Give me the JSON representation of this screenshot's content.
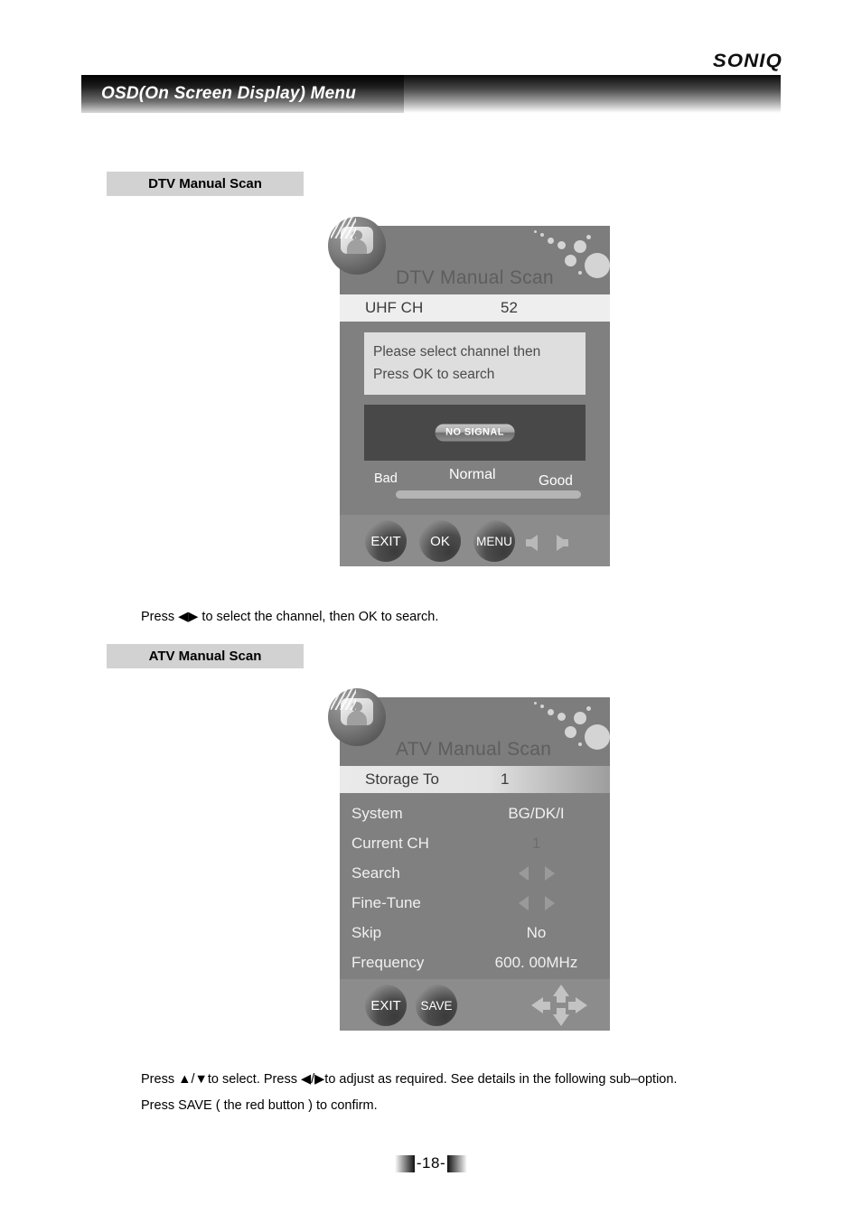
{
  "brand": {
    "name": "SONIQ"
  },
  "banner": {
    "title": "OSD(On Screen Display) Menu"
  },
  "sections": {
    "dtv": {
      "label": "DTV Manual Scan",
      "osd": {
        "title": "DTV Manual Scan",
        "icon": "tv-person-icon",
        "channel_row": {
          "label": "UHF  CH",
          "value": "52"
        },
        "message_line1": "Please select channel then",
        "message_line2": "Press OK to search",
        "preview_status": "NO SIGNAL",
        "scale": {
          "low": "Bad",
          "mid": "Normal",
          "high": "Good",
          "level_percent": 0
        },
        "buttons": [
          "EXIT",
          "OK",
          "MENU"
        ],
        "arrows": [
          "left-arrow",
          "right-arrow"
        ]
      },
      "instruction": "Press ◀▶   to select the channel, then OK to search."
    },
    "atv": {
      "label": "ATV Manual Scan",
      "osd": {
        "title": "ATV Manual Scan",
        "icon": "tv-person-icon",
        "highlight_row": {
          "label": "Storage To",
          "value": "1"
        },
        "items": [
          {
            "label": "System",
            "value": "BG/DK/I",
            "kind": "text"
          },
          {
            "label": "Current CH",
            "value": "1",
            "kind": "dim"
          },
          {
            "label": "Search",
            "value": "",
            "kind": "arrows"
          },
          {
            "label": "Fine-Tune",
            "value": "",
            "kind": "arrows"
          },
          {
            "label": "Skip",
            "value": "No",
            "kind": "text"
          },
          {
            "label": "Frequency",
            "value": "600. 00MHz",
            "kind": "text"
          }
        ],
        "buttons": [
          "EXIT",
          "SAVE"
        ],
        "dpad": "four-way-arrows"
      },
      "instruction_line1": "Press ▲/▼to select. Press ◀/▶to adjust as required. See details in the following sub–option.",
      "instruction_line2": "Press SAVE ( the red button ) to confirm."
    }
  },
  "footer": {
    "page_number": "-18-"
  },
  "colors": {
    "osd_bg": "#808080",
    "osd_header": "#7d7d7d",
    "highlight": "#eaeaea",
    "preview_bg": "#484848",
    "button_bar": "#8c8c8c"
  }
}
